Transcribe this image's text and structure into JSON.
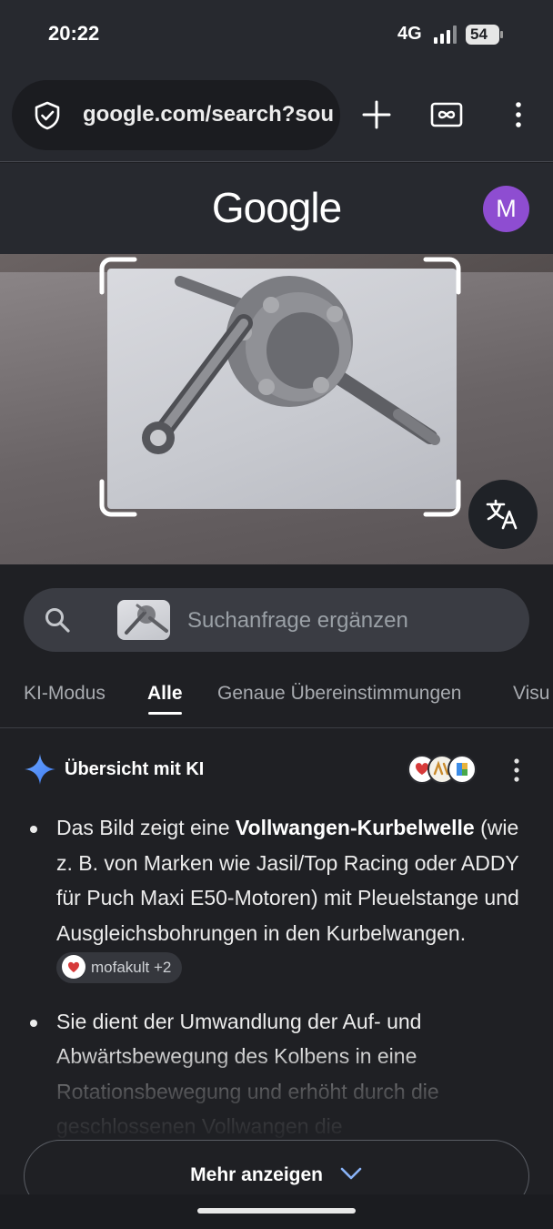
{
  "status": {
    "time": "20:22",
    "network": "4G",
    "battery": "54"
  },
  "browser": {
    "url": "google.com/search?sou"
  },
  "header": {
    "logo": "Google",
    "avatar_letter": "M"
  },
  "search": {
    "placeholder": "Suchanfrage ergänzen"
  },
  "tabs": [
    {
      "label": "KI-Modus"
    },
    {
      "label": "Alle"
    },
    {
      "label": "Genaue Übereinstimmungen"
    },
    {
      "label": "Visu"
    }
  ],
  "ai_overview": {
    "title": "Übersicht mit KI",
    "bullet1_pre": "Das Bild zeigt eine ",
    "bullet1_bold": "Vollwangen-Kurbelwelle",
    "bullet1_rest": " (wie z. B. von Marken wie Jasil/Top Racing oder ADDY für Puch Maxi E50-Motoren) mit Pleuelstange und Ausgleichsbohrungen in den Kurbelwangen. ",
    "chip_label": "mofakult +2",
    "bullet2": "Sie dient der Umwandlung der Auf- und Abwärtsbewegung des Kolbens in eine Rotationsbewegung und erhöht durch die geschlossenen Vollwangen die"
  },
  "more_button": {
    "label": "Mehr anzeigen"
  },
  "colors": {
    "background": "#1f2024",
    "avatar": "#8e4dd1",
    "spark": "#4f8df8"
  }
}
